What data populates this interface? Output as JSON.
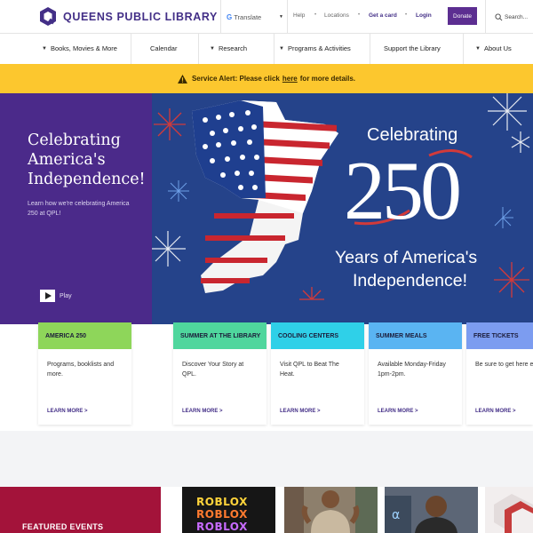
{
  "header": {
    "logo_text": "QUEENS PUBLIC LIBRARY",
    "translate_label": "Translate",
    "links": [
      "Help",
      "Locations",
      "Get a card",
      "Login"
    ],
    "donate_label": "Donate",
    "search_placeholder": "Search..."
  },
  "nav": {
    "items": [
      {
        "label": "Books, Movies & More",
        "has_menu": true
      },
      {
        "label": "Calendar",
        "has_menu": false
      },
      {
        "label": "Research",
        "has_menu": true
      },
      {
        "label": "Programs & Activities",
        "has_menu": true
      },
      {
        "label": "Support the Library",
        "has_menu": false
      },
      {
        "label": "About Us",
        "has_menu": true
      }
    ]
  },
  "alert": {
    "prefix": "Service Alert: Please click",
    "link_text": "here",
    "suffix": "for more details."
  },
  "hero": {
    "title": "Celebrating America's Independence!",
    "subtitle": "Learn how we're celebrating America 250 at QPL!",
    "play_label": "Play",
    "image_text": {
      "line1": "Celebrating",
      "number": "250",
      "line3": "Years of America's",
      "line4": "Independence!"
    }
  },
  "cards": [
    {
      "title": "AMERICA 250",
      "body": "Programs, booklists and more.",
      "link": "LEARN MORE >",
      "color": "#8ed65a"
    },
    {
      "title": "SUMMER AT THE LIBRARY",
      "body": "Discover Your Story at QPL.",
      "link": "LEARN MORE >",
      "color": "#4fd69d"
    },
    {
      "title": "COOLING CENTERS",
      "body": "Visit QPL to Beat The Heat.",
      "link": "LEARN MORE >",
      "color": "#2fd0e8"
    },
    {
      "title": "SUMMER MEALS",
      "body": "Available Monday-Friday 1pm-2pm.",
      "link": "LEARN MORE >",
      "color": "#5ab4f2"
    },
    {
      "title": "FREE TICKETS",
      "body": "Be sure to get here e",
      "link": "LEARN MORE >",
      "color": "#7c9cf0"
    }
  ],
  "featured": {
    "title": "FEATURED EVENTS",
    "roblox_words": [
      "ROBLOX",
      "ROBLOX",
      "ROBLOX"
    ]
  },
  "colors": {
    "brand_purple": "#432f87",
    "hero_purple": "#4b2a8a",
    "alert_yellow": "#fcc72e",
    "featured_red": "#a3133a",
    "hero_blue": "#25438a"
  }
}
